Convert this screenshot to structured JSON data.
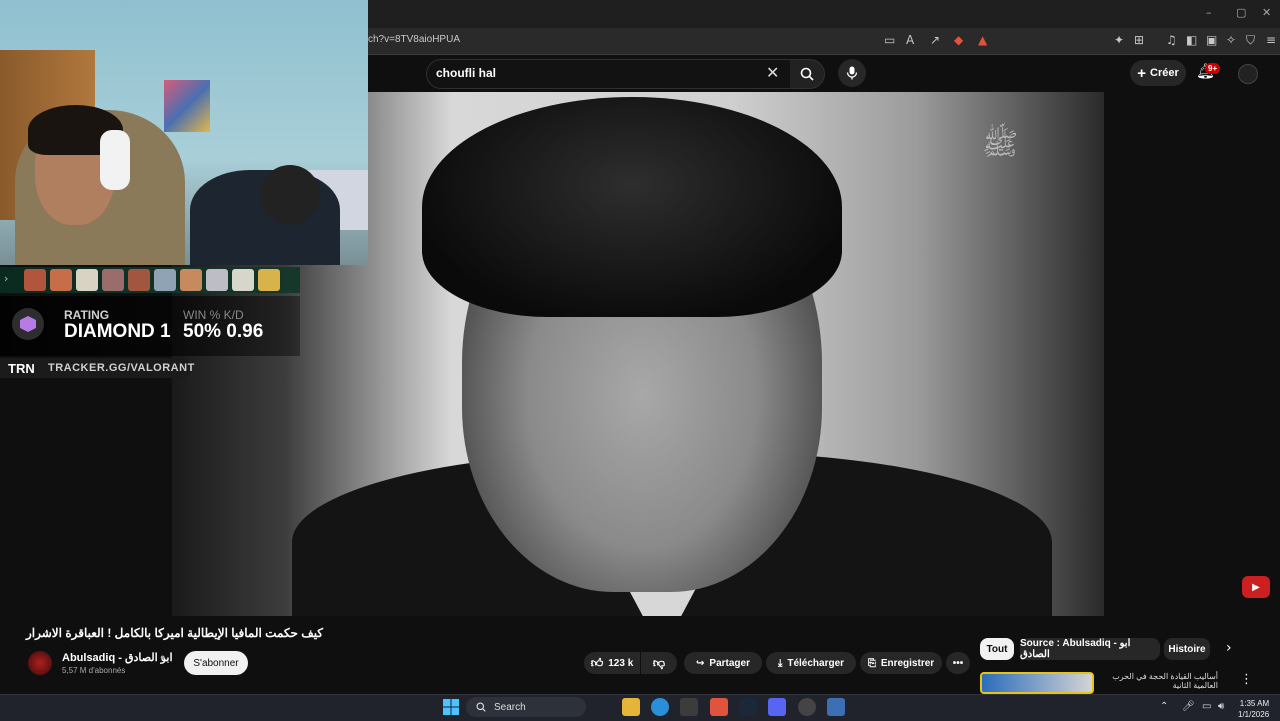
{
  "browser": {
    "url": "ch?v=8TV8aioHPUA",
    "window_controls": [
      "–",
      "▢",
      "✕"
    ]
  },
  "youtube_header": {
    "search_query": "choufli hal",
    "create_label": "Créer",
    "notif_count": "9+"
  },
  "overlay": {
    "rating_label": "RATING",
    "rating_value": "DIAMOND 1",
    "win_kd_label": "WIN % K/D",
    "win_kd_value": "50% 0.96",
    "trn_logo": "TRN",
    "tracker_url": "TRACKER.GG/VALORANT"
  },
  "video": {
    "title": "كيف حكمت المافيا الإيطالية اميركا بالكامل ! العباقرة الاشرار",
    "channel_name": "Abulsadiq - ابو الصادق",
    "subscribers": "5,57 M d'abonnés",
    "subscribe_label": "S'abonner",
    "likes": "123 k",
    "share_label": "Partager",
    "download_label": "Télécharger",
    "save_label": "Enregistrer",
    "more_label": "•••"
  },
  "chips": {
    "all": "Tout",
    "source": "Source : Abulsadiq - ابو الصادق",
    "history": "Histoire"
  },
  "recommendation": {
    "title": "أساليب القيادة الحجة في الحرب العالمية الثانية"
  },
  "taskbar": {
    "search_label": "Search",
    "time": "1:35 AM",
    "date": "1/1/2026"
  },
  "colors": {
    "youtube_bg": "#0f0f0f",
    "accent_red": "#cc0000",
    "taskbar": "#20232b"
  }
}
